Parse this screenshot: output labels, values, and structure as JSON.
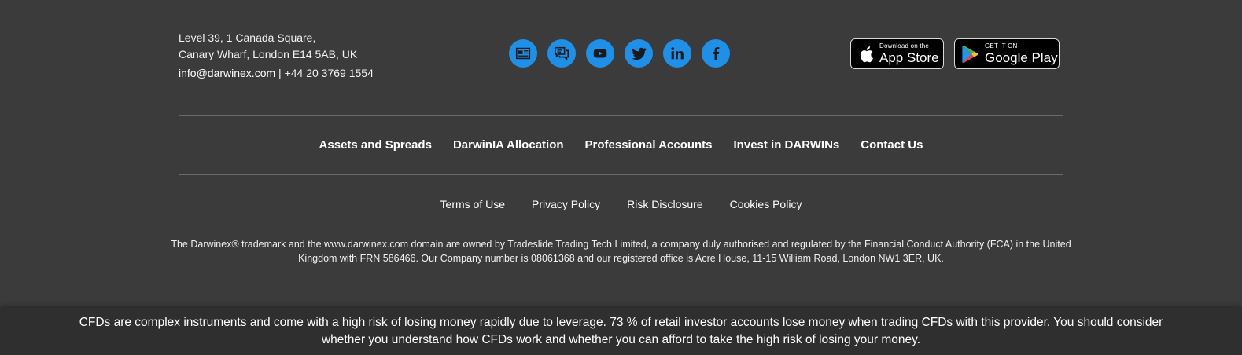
{
  "address": {
    "line1": "Level 39, 1 Canada Square,",
    "line2": "Canary Wharf, London E14 5AB, UK",
    "email": "info@darwinex.com",
    "separator": " | ",
    "phone": "+44 20 3769 1554"
  },
  "social": {
    "color": "#1e90e8",
    "icons": [
      "news-icon",
      "forum-icon",
      "youtube-icon",
      "twitter-icon",
      "linkedin-icon",
      "facebook-icon"
    ]
  },
  "stores": {
    "apple": {
      "small": "Download on the",
      "big": "App Store"
    },
    "google": {
      "small": "GET IT ON",
      "big": "Google Play"
    }
  },
  "main_nav": [
    "Assets and Spreads",
    "DarwinIA Allocation",
    "Professional Accounts",
    "Invest in DARWINs",
    "Contact Us"
  ],
  "legal_nav": [
    "Terms of Use",
    "Privacy Policy",
    "Risk Disclosure",
    "Cookies Policy"
  ],
  "disclaimer": "The Darwinex® trademark and the www.darwinex.com domain are owned by Tradeslide Trading Tech Limited, a company duly authorised and regulated by the Financial Conduct Authority (FCA) in the United Kingdom with FRN 586466. Our Company number is 08061368 and our registered office is Acre House, 11-15 William Road, London NW1 3ER, UK.",
  "risk_warning": "CFDs are complex instruments and come with a high risk of losing money rapidly due to leverage. 73 % of retail investor accounts lose money when trading CFDs with this provider. You should consider whether you understand how CFDs work and whether you can afford to take the high risk of losing your money."
}
